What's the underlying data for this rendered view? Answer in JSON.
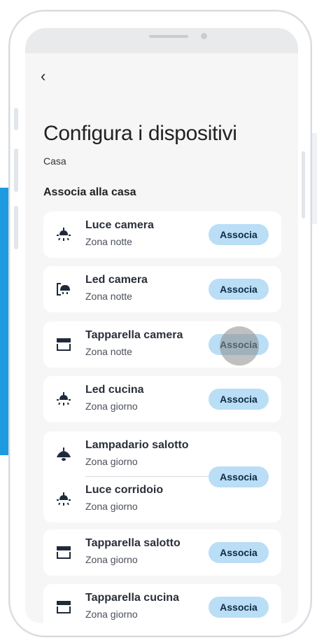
{
  "header": {
    "back_label": "‹",
    "title": "Configura i dispositivi",
    "subtitle": "Casa"
  },
  "section": {
    "title": "Associa alla casa"
  },
  "button_label": "Associa",
  "devices": [
    {
      "name": "Luce camera",
      "zone": "Zona notte",
      "icon": "ceiling-light-icon"
    },
    {
      "name": "Led camera",
      "zone": "Zona notte",
      "icon": "wall-light-icon"
    },
    {
      "name": "Tapparella camera",
      "zone": "Zona notte",
      "icon": "shutter-icon"
    },
    {
      "name": "Led cucina",
      "zone": "Zona giorno",
      "icon": "ceiling-light-icon"
    },
    {
      "name": "Lampadario salotto",
      "zone": "Zona giorno",
      "icon": "chandelier-icon"
    },
    {
      "name": "Luce corridoio",
      "zone": "Zona giorno",
      "icon": "ceiling-light-icon"
    },
    {
      "name": "Tapparella salotto",
      "zone": "Zona giorno",
      "icon": "shutter-icon"
    },
    {
      "name": "Tapparella cucina",
      "zone": "Zona giorno",
      "icon": "shutter-icon"
    }
  ],
  "colors": {
    "accent_button": "#b9def6",
    "button_text": "#0f2a44",
    "background": "#f6f6f7",
    "side_banner": "#1e9be0"
  }
}
